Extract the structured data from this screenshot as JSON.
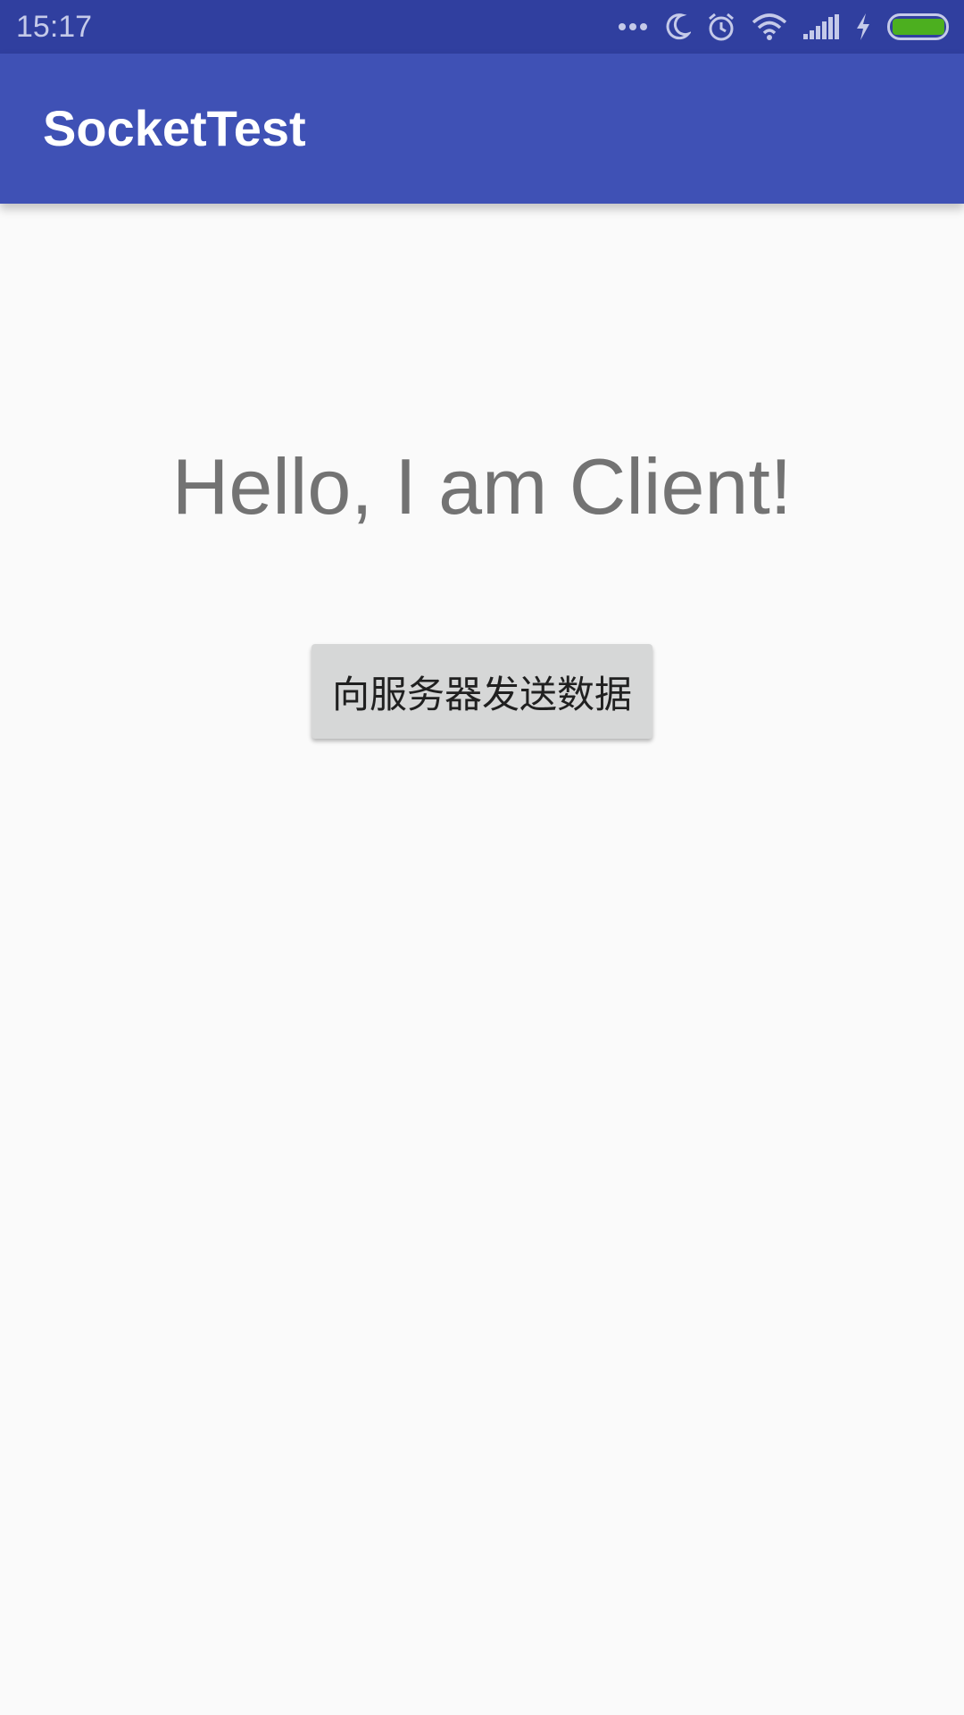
{
  "status_bar": {
    "time": "15:17",
    "icons": [
      "more-dots-icon",
      "moon-icon",
      "alarm-icon",
      "wifi-icon",
      "signal-icon",
      "charging-bolt-icon",
      "battery-icon"
    ],
    "battery_level": 0.95,
    "battery_color": "#4caf1f",
    "background_color": "#303f9f"
  },
  "app_bar": {
    "title": "SocketTest",
    "background_color": "#3f51b5"
  },
  "main": {
    "hello_text": "Hello, I am Client!",
    "send_button_label": "向服务器发送数据"
  }
}
